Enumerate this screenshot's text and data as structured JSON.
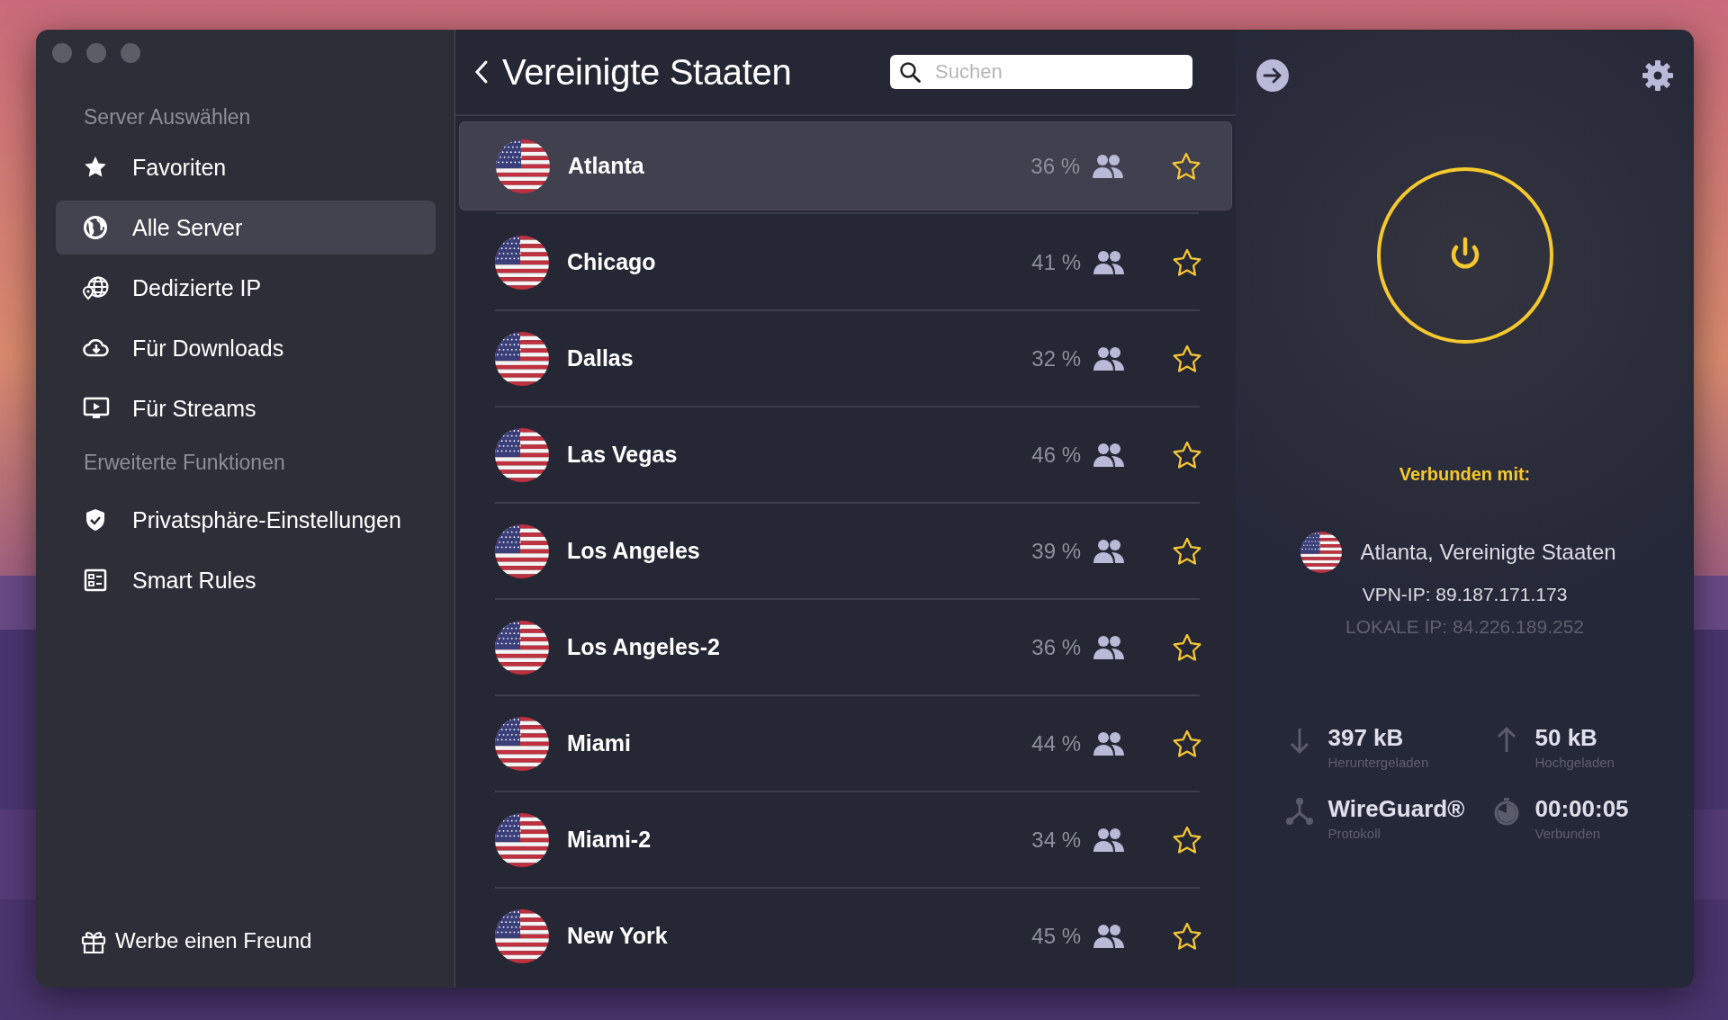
{
  "sidebar": {
    "sections": [
      {
        "heading": "Server Auswählen",
        "items": [
          {
            "label": "Favoriten",
            "selected": false
          },
          {
            "label": "Alle Server",
            "selected": true
          },
          {
            "label": "Dedizierte IP",
            "selected": false
          },
          {
            "label": "Für Downloads",
            "selected": false
          },
          {
            "label": "Für Streams",
            "selected": false
          }
        ]
      },
      {
        "heading": "Erweiterte Funktionen",
        "items": [
          {
            "label": "Privatsphäre-Einstellungen",
            "selected": false
          },
          {
            "label": "Smart Rules",
            "selected": false
          }
        ]
      }
    ],
    "referral": "Werbe einen Freund"
  },
  "server_list": {
    "title": "Vereinigte Staaten",
    "search": {
      "placeholder": "Suchen"
    },
    "servers": [
      {
        "name": "Atlanta",
        "load": "36 %",
        "selected": true,
        "favorite": false
      },
      {
        "name": "Chicago",
        "load": "41 %",
        "selected": false,
        "favorite": false
      },
      {
        "name": "Dallas",
        "load": "32 %",
        "selected": false,
        "favorite": false
      },
      {
        "name": "Las Vegas",
        "load": "46 %",
        "selected": false,
        "favorite": false
      },
      {
        "name": "Los Angeles",
        "load": "39 %",
        "selected": false,
        "favorite": false
      },
      {
        "name": "Los Angeles-2",
        "load": "36 %",
        "selected": false,
        "favorite": false
      },
      {
        "name": "Miami",
        "load": "44 %",
        "selected": false,
        "favorite": false
      },
      {
        "name": "Miami-2",
        "load": "34 %",
        "selected": false,
        "favorite": false
      },
      {
        "name": "New York",
        "load": "45 %",
        "selected": false,
        "favorite": false
      }
    ]
  },
  "status": {
    "connected": true,
    "heading": "Verbunden mit:",
    "location": "Atlanta, Vereinigte Staaten",
    "vpn_ip": "VPN-IP: 89.187.171.173",
    "local_ip": "LOKALE IP: 84.226.189.252",
    "stats": [
      {
        "value": "397 kB",
        "label": "Heruntergeladen"
      },
      {
        "value": "50 kB",
        "label": "Hochgeladen"
      },
      {
        "value": "WireGuard®",
        "label": "Protokoll"
      },
      {
        "value": "00:00:05",
        "label": "Verbunden"
      }
    ]
  }
}
